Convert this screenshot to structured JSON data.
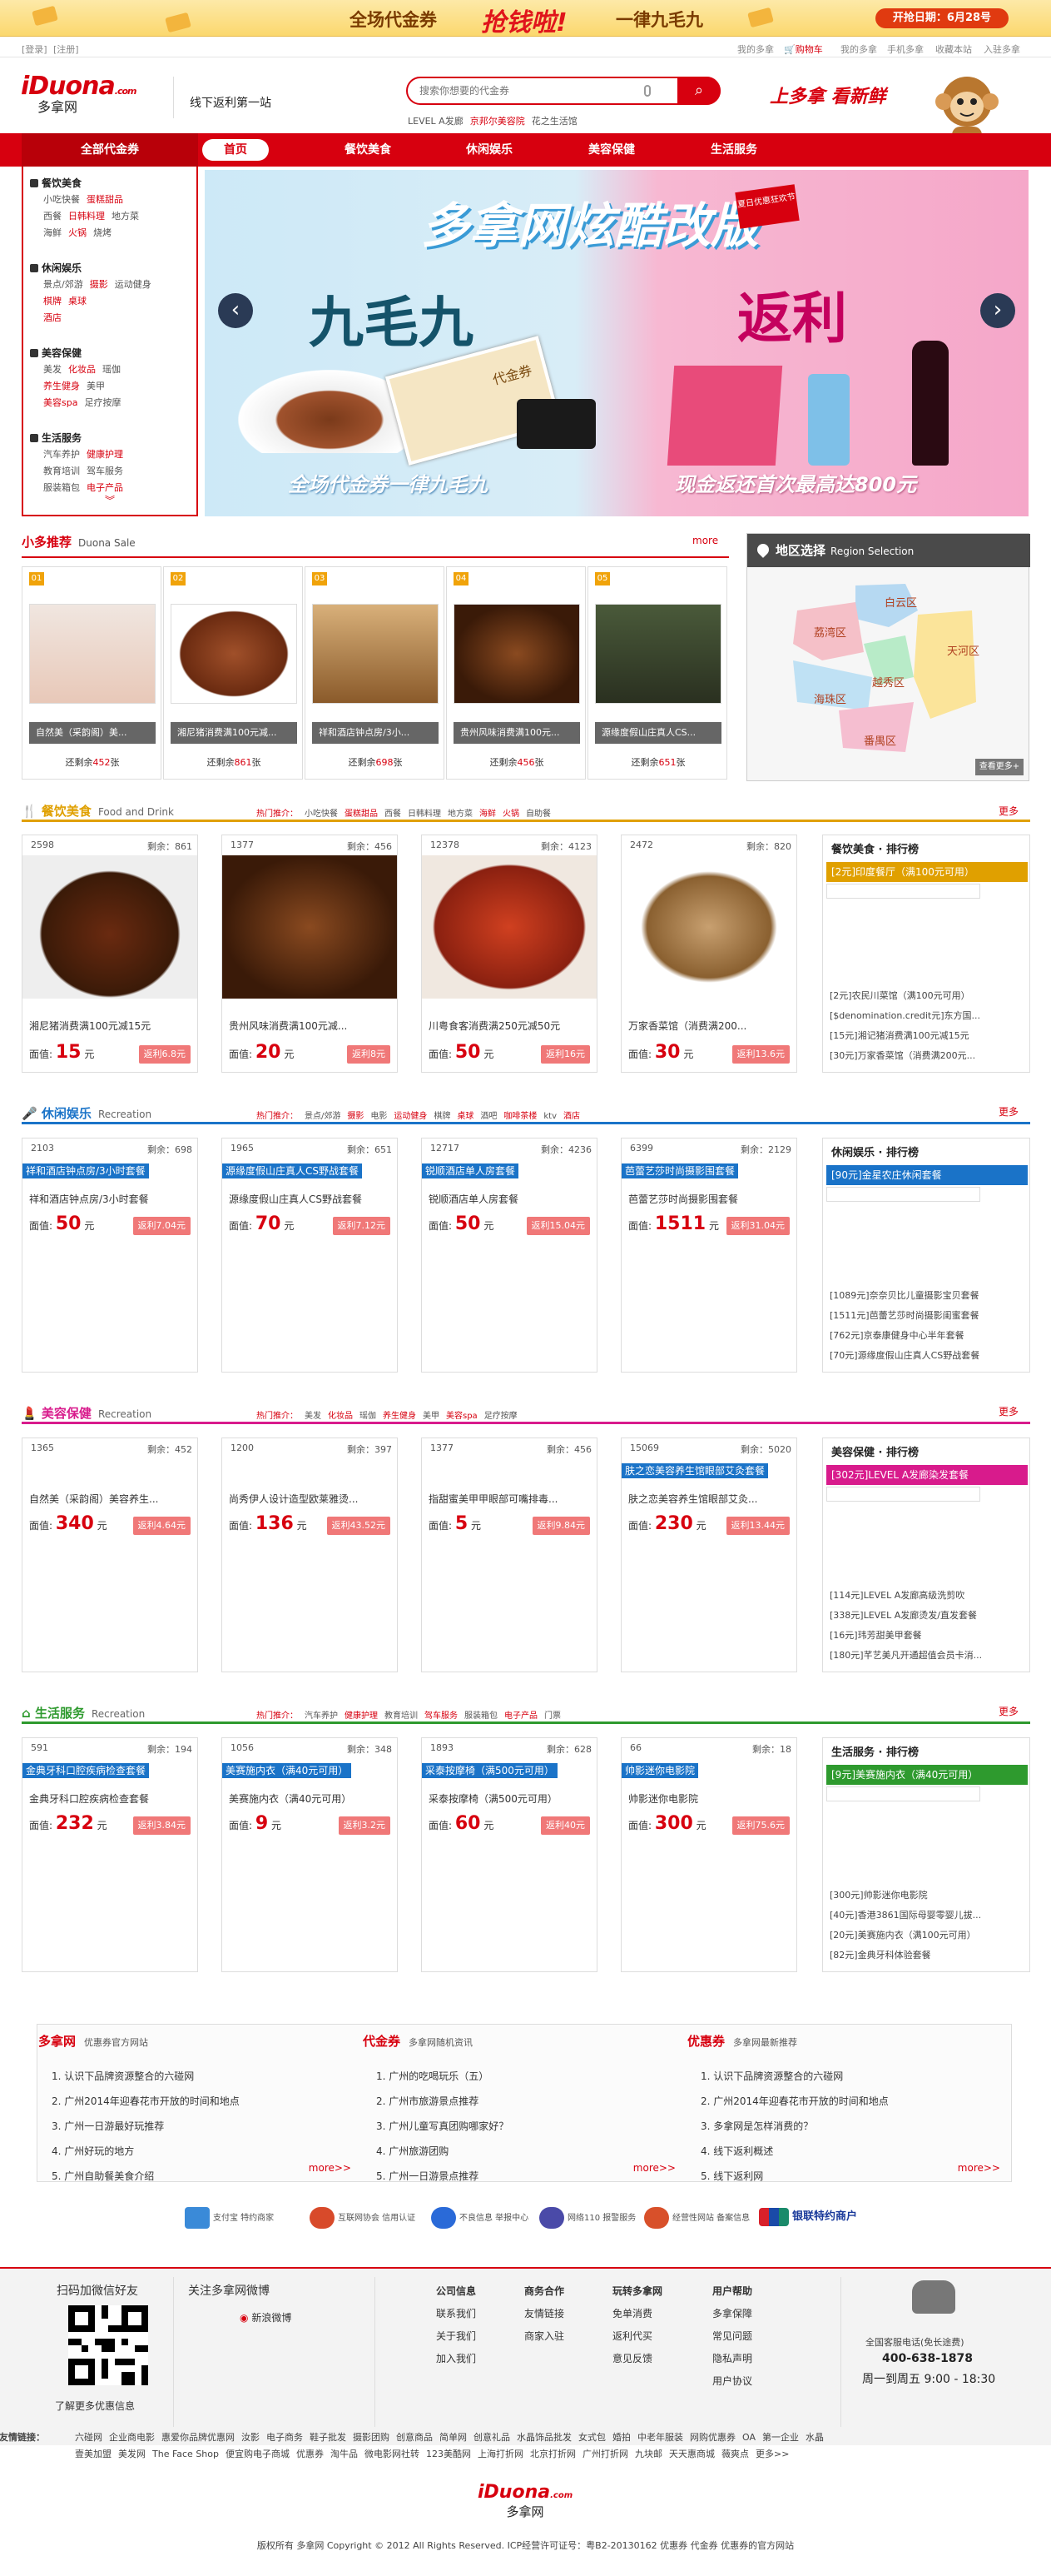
{
  "promo": {
    "text1": "全场代金券",
    "text2": "抢钱啦!",
    "text3": "一律九毛九",
    "date": "开抢日期：6月28号"
  },
  "util": {
    "login": "[登录]",
    "register": "[注册]",
    "my_account": "我的多拿",
    "cart": "购物车",
    "my_account2": "我的多拿",
    "mobile": "手机多拿",
    "favorite": "收藏本站",
    "settle": "入驻多拿"
  },
  "header": {
    "logo_main": "iDuona",
    "logo_suffix": ".com",
    "logo_cn": "多拿网",
    "slogan": "线下返利第一站",
    "search_placeholder": "搜索你想要的代金券",
    "hot_words": [
      "LEVEL A发廊",
      "京邦尔美容院",
      "花之生活馆"
    ],
    "shopping_text": "上多拿 看新鲜"
  },
  "nav": {
    "all": "全部代金券",
    "items": [
      "首页",
      "餐饮美食",
      "休闲娱乐",
      "美容保健",
      "生活服务"
    ]
  },
  "categories": [
    {
      "title": "餐饮美食",
      "items": [
        "小吃快餐",
        "蛋糕甜品",
        "西餐",
        "日韩料理",
        "地方菜",
        "海鲜",
        "火锅",
        "烧烤"
      ]
    },
    {
      "title": "休闲娱乐",
      "items": [
        "景点/郊游",
        "摄影",
        "运动健身",
        "棋牌",
        "桌球",
        "酒店"
      ]
    },
    {
      "title": "美容保健",
      "items": [
        "美发",
        "化妆品",
        "瑶伽",
        "养生健身",
        "美甲",
        "美容spa",
        "足疗按摩"
      ]
    },
    {
      "title": "生活服务",
      "items": [
        "汽车养护",
        "健康护理",
        "教育培训",
        "驾车服务",
        "服装箱包",
        "电子产品"
      ]
    }
  ],
  "banner": {
    "title": "多拿网炫酷改版",
    "tag": "夏日优惠狂欢节",
    "left": "九毛九",
    "right": "返利",
    "cap_left": "全场代金券一律九毛九",
    "cap_right": "现金返还首次最高达800元",
    "coupon": "代金券"
  },
  "xiaoduo": {
    "title": "小多推荐",
    "subtitle": "Duona Sale",
    "more": "more",
    "items": [
      {
        "num": "01",
        "name": "自然美（采韵阁）美...",
        "remain_pre": "还剩余",
        "remain": "452",
        "remain_suf": "张"
      },
      {
        "num": "02",
        "name": "湘尼猪消费满100元减...",
        "remain_pre": "还剩余",
        "remain": "861",
        "remain_suf": "张"
      },
      {
        "num": "03",
        "name": "祥和酒店钟点房/3小...",
        "remain_pre": "还剩余",
        "remain": "698",
        "remain_suf": "张"
      },
      {
        "num": "04",
        "name": "贵州风味消费满100元...",
        "remain_pre": "还剩余",
        "remain": "456",
        "remain_suf": "张"
      },
      {
        "num": "05",
        "name": "源缘度假山庄真人CS...",
        "remain_pre": "还剩余",
        "remain": "651",
        "remain_suf": "张"
      }
    ]
  },
  "region": {
    "title": "地区选择",
    "subtitle": "Region Selection",
    "districts": [
      "白云区",
      "荔湾区",
      "越秀区",
      "天河区",
      "海珠区",
      "番禺区"
    ],
    "button": "查看更多+"
  },
  "sections": [
    {
      "key": "food",
      "title": "餐饮美食",
      "en": "Food and Drink",
      "hot_label": "热门推介：",
      "hot": [
        "小吃快餐",
        "蛋糕甜品",
        "西餐",
        "日韩料理",
        "地方菜",
        "海鲜",
        "火锅",
        "自助餐"
      ],
      "more": "更多",
      "products": [
        {
          "likes": "2598",
          "remain": "剩余：861",
          "name": "湘尼猪消费满100元减15元",
          "price": "15",
          "unit": "元",
          "rebate": "返利6.8元",
          "price_label": "面值:"
        },
        {
          "likes": "1377",
          "remain": "剩余：456",
          "name": "贵州风味消费满100元减...",
          "price": "20",
          "unit": "元",
          "rebate": "返利8元",
          "price_label": "面值:"
        },
        {
          "likes": "12378",
          "remain": "剩余：4123",
          "name": "川粤食客消费满250元减50元",
          "price": "50",
          "unit": "元",
          "rebate": "返利16元",
          "price_label": "面值:"
        },
        {
          "likes": "2472",
          "remain": "剩余：820",
          "name": "万家香菜馆（消费满200...",
          "price": "30",
          "unit": "元",
          "rebate": "返利13.6元",
          "price_label": "面值:"
        }
      ],
      "rank": {
        "title": "餐饮美食 · 排行榜",
        "first": "[2元]印度餐厅（满100元可用）",
        "items": [
          "[2元]农民川菜馆（满100元可用）",
          "[$denomination.credit元]东方国...",
          "[15元]湘记猪消费满100元减15元",
          "[30元]万家香菜馆（消费满200元..."
        ]
      }
    },
    {
      "key": "ent",
      "title": "休闲娱乐",
      "en": "Recreation",
      "hot_label": "热门推介：",
      "hot": [
        "景点/郊游",
        "摄影",
        "电影",
        "运动健身",
        "棋牌",
        "桌球",
        "酒吧",
        "咖啡茶楼",
        "ktv",
        "酒店"
      ],
      "more": "更多",
      "products": [
        {
          "likes": "2103",
          "remain": "剩余：698",
          "hl": "祥和酒店钟点房/3小时套餐",
          "name": "祥和酒店钟点房/3小时套餐",
          "price": "50",
          "unit": "元",
          "rebate": "返利7.04元",
          "price_label": "面值:"
        },
        {
          "likes": "1965",
          "remain": "剩余：651",
          "hl": "源缘度假山庄真人CS野战套餐",
          "name": "源缘度假山庄真人CS野战套餐",
          "price": "70",
          "unit": "元",
          "rebate": "返利7.12元",
          "price_label": "面值:"
        },
        {
          "likes": "12717",
          "remain": "剩余：4236",
          "hl": "锐顺酒店单人房套餐",
          "name": "锐顺酒店单人房套餐",
          "price": "50",
          "unit": "元",
          "rebate": "返利15.04元",
          "price_label": "面值:"
        },
        {
          "likes": "6399",
          "remain": "剩余：2129",
          "hl": "芭蕾艺莎时尚摄影围套餐",
          "name": "芭蕾艺莎时尚摄影围套餐",
          "price": "1511",
          "unit": "元",
          "rebate": "返利31.04元",
          "price_label": "面值:"
        }
      ],
      "rank": {
        "title": "休闲娱乐 · 排行榜",
        "first": "[90元]金星农庄休闲套餐",
        "items": [
          "[1089元]奈奈贝比儿童摄影宝贝套餐",
          "[1511元]芭蕾艺莎时尚摄影闺蜜套餐",
          "[762元]京泰康健身中心半年套餐",
          "[70元]源缘度假山庄真人CS野战套餐"
        ]
      }
    },
    {
      "key": "beauty",
      "title": "美容保健",
      "en": "Recreation",
      "hot_label": "热门推介：",
      "hot": [
        "美发",
        "化妆品",
        "瑶伽",
        "养生健身",
        "美甲",
        "美容spa",
        "足疗按摩"
      ],
      "more": "更多",
      "products": [
        {
          "likes": "1365",
          "remain": "剩余：452",
          "name": "自然美（采韵阁）美容养生...",
          "price": "340",
          "unit": "元",
          "rebate": "返利4.64元",
          "price_label": "面值:"
        },
        {
          "likes": "1200",
          "remain": "剩余：397",
          "name": "尚秀伊人设计造型欧莱雅烫...",
          "price": "136",
          "unit": "元",
          "rebate": "返利43.52元",
          "price_label": "面值:"
        },
        {
          "likes": "1377",
          "remain": "剩余：456",
          "name": "指甜蜜美甲甲眼部可嘴排毒...",
          "price": "5",
          "unit": "元",
          "rebate": "返利9.84元",
          "price_label": "面值:"
        },
        {
          "likes": "15069",
          "remain": "剩余：5020",
          "hl": "肤之恋美容养生馆眼部艾灸套餐",
          "name": "肤之恋美容养生馆眼部艾灸...",
          "price": "230",
          "unit": "元",
          "rebate": "返利13.44元",
          "price_label": "面值:"
        }
      ],
      "rank": {
        "title": "美容保健 · 排行榜",
        "first": "[302元]LEVEL A发廊染发套餐",
        "items": [
          "[114元]LEVEL A发廊高级洗剪吹",
          "[338元]LEVEL A发廊烫发/直发套餐",
          "[16元]玮芳甜美甲套餐",
          "[180元]芊艺美凡开通超值会员卡消..."
        ]
      }
    },
    {
      "key": "life",
      "title": "生活服务",
      "en": "Recreation",
      "hot_label": "热门推介：",
      "hot": [
        "汽车养护",
        "健康护理",
        "教育培训",
        "驾车服务",
        "服装箱包",
        "电子产品",
        "门票"
      ],
      "more": "更多",
      "products": [
        {
          "likes": "591",
          "remain": "剩余：194",
          "hl": "金典牙科口腔疾病检查套餐",
          "name": "金典牙科口腔疾病检查套餐",
          "price": "232",
          "unit": "元",
          "rebate": "返利3.84元",
          "price_label": "面值:"
        },
        {
          "likes": "1056",
          "remain": "剩余：348",
          "hl": "美赛施内衣（满40元可用）",
          "name": "美赛施内衣（满40元可用）",
          "price": "9",
          "unit": "元",
          "rebate": "返利3.2元",
          "price_label": "面值:"
        },
        {
          "likes": "1893",
          "remain": "剩余：628",
          "hl": "采泰按摩椅（满500元可用）",
          "name": "采泰按摩椅（满500元可用）",
          "price": "60",
          "unit": "元",
          "rebate": "返利40元",
          "price_label": "面值:"
        },
        {
          "likes": "66",
          "remain": "剩余：18",
          "hl": "帅影迷你电影院",
          "name": "帅影迷你电影院",
          "price": "300",
          "unit": "元",
          "rebate": "返利75.6元",
          "price_label": "面值:"
        }
      ],
      "rank": {
        "title": "生活服务 · 排行榜",
        "first": "[9元]美赛施内衣（满40元可用）",
        "items": [
          "[300元]帅影迷你电影院",
          "[40元]香港3861国际母婴零婴儿拔...",
          "[20元]美赛施内衣（满100元可用）",
          "[82元]金典牙科体验套餐"
        ]
      }
    }
  ],
  "info": [
    {
      "title": "多拿网",
      "sub": "优惠券官方网站",
      "items": [
        "1. 认识下品牌资源整合的六碰网",
        "2. 广州2014年迎春花市开放的时间和地点",
        "3. 广州一日游最好玩推荐",
        "4. 广州好玩的地方",
        "5. 广州自助餐美食介绍"
      ],
      "more": "more>>"
    },
    {
      "title": "代金券",
      "sub": "多拿网随机资讯",
      "items": [
        "1. 广州的吃喝玩乐（五）",
        "2. 广州市旅游景点推荐",
        "3. 广州儿童写真团购哪家好？",
        "4. 广州旅游团购",
        "5. 广州一日游景点推荐"
      ],
      "more": "more>>"
    },
    {
      "title": "优惠券",
      "sub": "多拿网最新推荐",
      "items": [
        "1. 认识下品牌资源整合的六碰网",
        "2. 广州2014年迎春花市开放的时间和地点",
        "3. 多拿网是怎样消费的？",
        "4. 线下返利概述",
        "5. 线下返利网"
      ],
      "more": "more>>"
    }
  ],
  "trust": [
    "支付宝 特约商家",
    "互联网协会 信用认证",
    "不良信息 举报中心",
    "网络110 报警服务",
    "经营性网站 备案信息",
    "银联特约商户"
  ],
  "footer": {
    "qr_title": "扫码加微信好友",
    "qr_more": "了解更多优惠信息",
    "weibo_title": "关注多拿网微博",
    "weibo": "新浪微博",
    "cols": [
      {
        "title": "公司信息",
        "items": [
          "联系我们",
          "关于我们",
          "加入我们"
        ]
      },
      {
        "title": "商务合作",
        "items": [
          "友情链接",
          "商家入驻"
        ]
      },
      {
        "title": "玩转多拿网",
        "items": [
          "免单消费",
          "返利代买",
          "意见反馈"
        ]
      },
      {
        "title": "用户帮助",
        "items": [
          "多拿保障",
          "常见问题",
          "隐私声明",
          "用户协议"
        ]
      }
    ],
    "hotline_label": "全国客服电话(免长途费)",
    "hotline": "400-638-1878",
    "hours": "周一到周五 9:00 - 18:30"
  },
  "friends": {
    "label": "友情链接：",
    "line1": [
      "六碰网",
      "企业商电影",
      "惠爱你品牌优惠网",
      "汝影",
      "电子商务",
      "鞋子批发",
      "摄影团购",
      "创意商品",
      "简单网",
      "创意礼品",
      "水晶饰品批发",
      "女式包",
      "婚拍",
      "中老年服装",
      "网购优惠券",
      "OA",
      "第一企业",
      "水晶"
    ],
    "line2": [
      "壹美加盟",
      "美发网",
      "The Face Shop",
      "便宜购电子商城",
      "优惠券",
      "淘牛品",
      "微电影网社转",
      "123美酷网",
      "上海打折网",
      "北京打折网",
      "广州打折网",
      "九块邮",
      "天天惠商城",
      "薇爽点",
      "更多>>"
    ]
  },
  "bottom": {
    "logo": "iDuona",
    "logo_suffix": ".com",
    "cn": "多拿网",
    "copyright": "版权所有 多拿网  Copyright © 2012 All Rights Reserved. ICP经营许可证号：粤B2-20130162  优惠券  代金券  优惠券的官方网站"
  }
}
